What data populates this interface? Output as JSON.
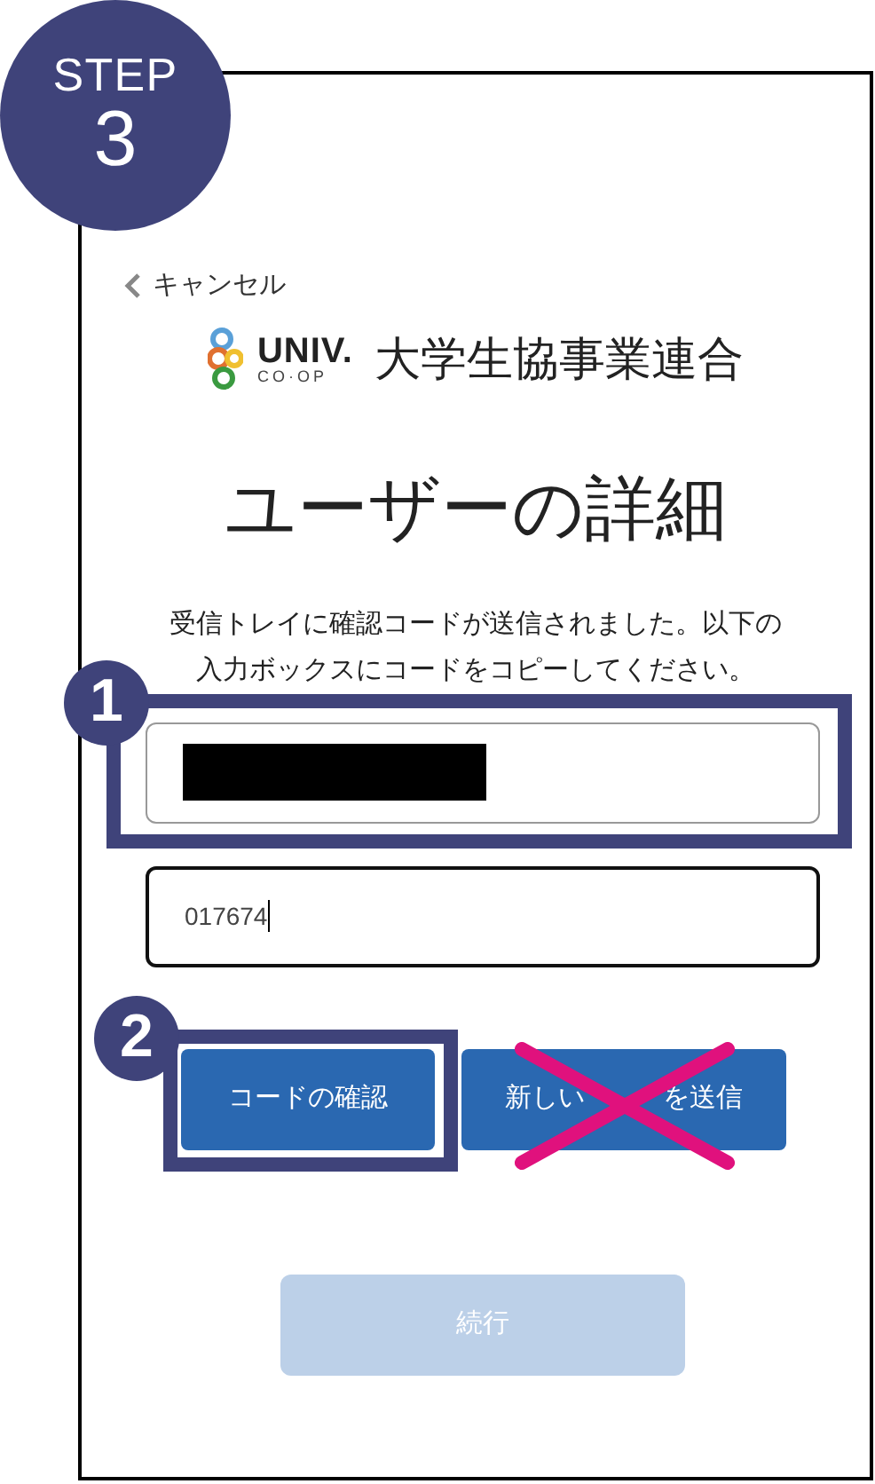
{
  "step": {
    "label": "STEP",
    "number": "3"
  },
  "cancel_link": "キャンセル",
  "logo": {
    "mark_top": "UNIV.",
    "mark_bottom": "CO·OP",
    "name": "大学生協事業連合"
  },
  "title": "ユーザーの詳細",
  "message": [
    "受信トレイに確認コードが送信されました。以下の",
    "入力ボックスにコードをコピーしてください。"
  ],
  "fields": [
    {
      "kind": "redacted",
      "focused": false,
      "annotation": "1"
    },
    {
      "kind": "text",
      "value": "017674",
      "focused": true
    }
  ],
  "buttons": [
    {
      "label": [
        "コードの確認"
      ],
      "annotation": "2"
    },
    {
      "label": [
        "新しい",
        "を送信"
      ],
      "crossed_out": true
    }
  ],
  "continue_button": {
    "label": "続行",
    "disabled": true
  }
}
